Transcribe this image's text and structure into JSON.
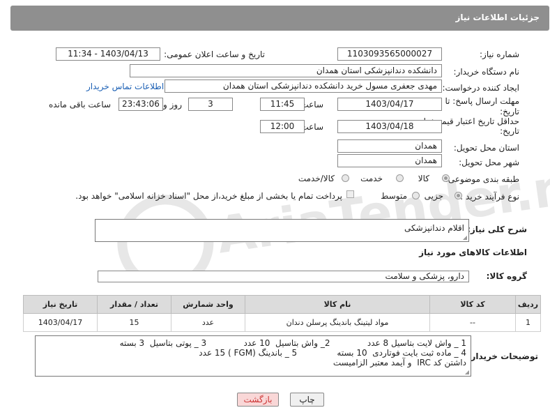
{
  "header": {
    "title": "جزئیات اطلاعات نیاز"
  },
  "fields": {
    "need_number_label": "شماره نیاز:",
    "need_number": "1103093565000027",
    "announce_label": "تاریخ و ساعت اعلان عمومی:",
    "announce_value": "1403/04/13 - 11:34",
    "buyer_org_label": "نام دستگاه خریدار:",
    "buyer_org": "دانشکدە دندانپزشکی استان همدان",
    "creator_label": "ایجاد کننده درخواست:",
    "creator": "مهدی جعفری مسول خرید دانشکده دندانپزشکی استان همدان",
    "contact_link": "اطلاعات تماس خریدار",
    "reply_deadline_label_1": "مهلت ارسال پاسخ: تا",
    "reply_deadline_label_2": "تاریخ:",
    "reply_date": "1403/04/17",
    "time_label": "ساعت",
    "reply_time": "11:45",
    "days": "3",
    "days_label": "روز و",
    "remaining_time": "23:43:06",
    "remaining_label": "ساعت باقی مانده",
    "price_validity_label_1": "حداقل تاریخ اعتبار قیمت: تا",
    "price_validity_label_2": "تاریخ:",
    "price_date": "1403/04/18",
    "price_time": "12:00",
    "province_label": "استان محل تحویل:",
    "province": "همدان",
    "city_label": "شهر محل تحویل:",
    "city": "همدان",
    "category_label": "طبقه بندی موضوعی:",
    "category_options": [
      "کالا",
      "خدمت",
      "کالا/خدمت"
    ],
    "process_label": "نوع فرآیند خرید :",
    "process_options": [
      "جزیی",
      "متوسط"
    ],
    "payment_note": "پرداخت تمام یا بخشی از مبلغ خرید،از محل \"اسناد خزانه اسلامی\" خواهد بود."
  },
  "description": {
    "label": "شرح کلی نیاز:",
    "value": "اقلام دندانپزشکی"
  },
  "goods_section": {
    "title": "اطلاعات کالاهای مورد نیاز",
    "group_label": "گروه کالا:",
    "group_value": "دارو، پزشکی و سلامت"
  },
  "table": {
    "headers": [
      "ردیف",
      "کد کالا",
      "نام کالا",
      "واحد شمارش",
      "تعداد / مقدار",
      "تاریخ نیاز"
    ],
    "rows": [
      [
        "1",
        "--",
        "مواد لیتینگ باندینگ پرسلن دندان",
        "عدد",
        "15",
        "1403/04/17"
      ]
    ]
  },
  "notes": {
    "label": "توضیحات خریدار:",
    "lines": [
      "1 _ واش لایت بتاسیل 8 عدد              2_ واش بتاسیل  10 عدد              3 _ پوتی بتاسیل  3 بسته",
      "4 _ ماده ثبت بایت فوتاردی  10 بسته               5 _ باندینگ (FGM ) 15 عدد",
      "داشتن کد IRC  و آیمد معتبر الزامیست"
    ]
  },
  "buttons": {
    "print": "چاپ",
    "back": "بازگشت"
  },
  "watermark": {
    "text": "AriaTender.net"
  }
}
